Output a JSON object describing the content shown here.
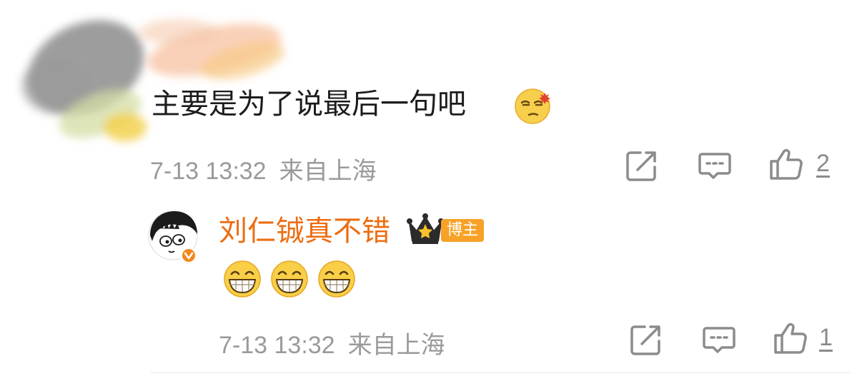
{
  "comment": {
    "text": "主要是为了说最后一句吧",
    "emoji": "dizzy-face-emoji",
    "timestamp": "7-13 13:32",
    "location": "来自上海",
    "like_count": "2"
  },
  "reply": {
    "username": "刘仁铖真不错",
    "badge": "博主",
    "emojis": [
      "grin-emoji",
      "grin-emoji",
      "grin-emoji"
    ],
    "timestamp": "7-13 13:32",
    "location": "来自上海",
    "like_count": "1"
  },
  "icons": {
    "share": "share-icon",
    "comment": "comment-icon",
    "like": "thumbs-up-icon"
  },
  "colors": {
    "username": "#ec6d12",
    "badge_bg": "#f7a227",
    "meta_text": "#9a9a9a",
    "icon_stroke": "#8c8c8c"
  }
}
